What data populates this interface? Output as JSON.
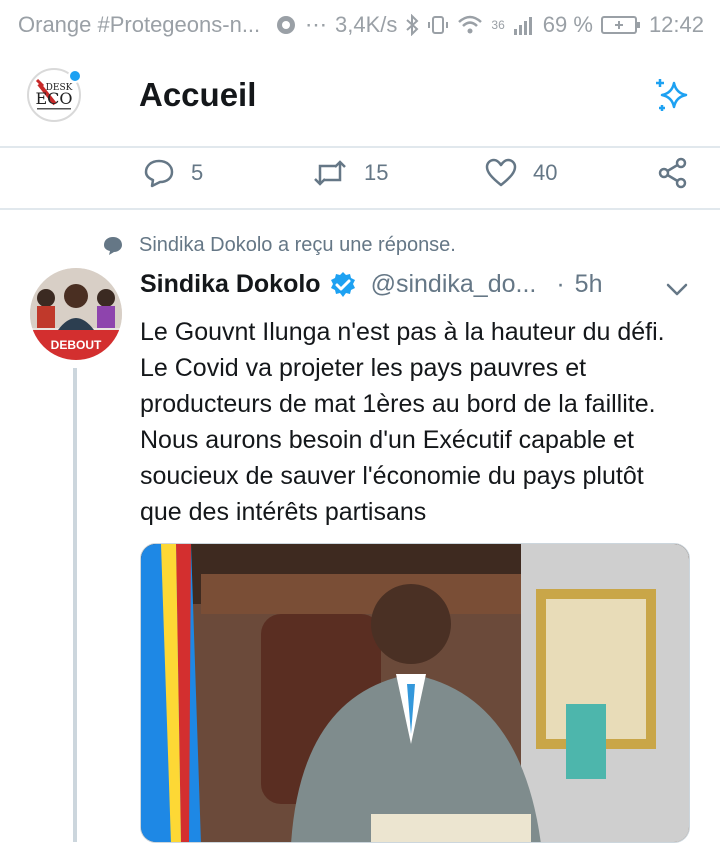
{
  "status_bar": {
    "carrier": "Orange #Protegeons-n...",
    "speed": "3,4K/s",
    "network": "36",
    "battery": "69 %",
    "time": "12:42"
  },
  "header": {
    "title": "Accueil",
    "avatar_logo_text": "DESK ECO"
  },
  "prev_tweet_actions": {
    "replies": "5",
    "retweets": "15",
    "likes": "40"
  },
  "context": {
    "reply_notice": "Sindika Dokolo a reçu une réponse."
  },
  "tweet": {
    "author_name": "Sindika Dokolo",
    "handle": "@sindika_do...",
    "separator": "·",
    "time": "5h",
    "text": "Le Gouvnt Ilunga n'est pas à la hauteur du défi. Le Covid va projeter les pays pauvres et producteurs de mat 1ères au bord de la faillite. Nous aurons besoin d'un Exécutif capable et soucieux de sauver l'économie du pays plutôt que des intérêts partisans",
    "avatar_caption": "DEBOUT"
  },
  "colors": {
    "accent": "#1da1f2",
    "verified": "#1da1f2",
    "muted": "#657786",
    "divider": "#e1e8ed"
  }
}
